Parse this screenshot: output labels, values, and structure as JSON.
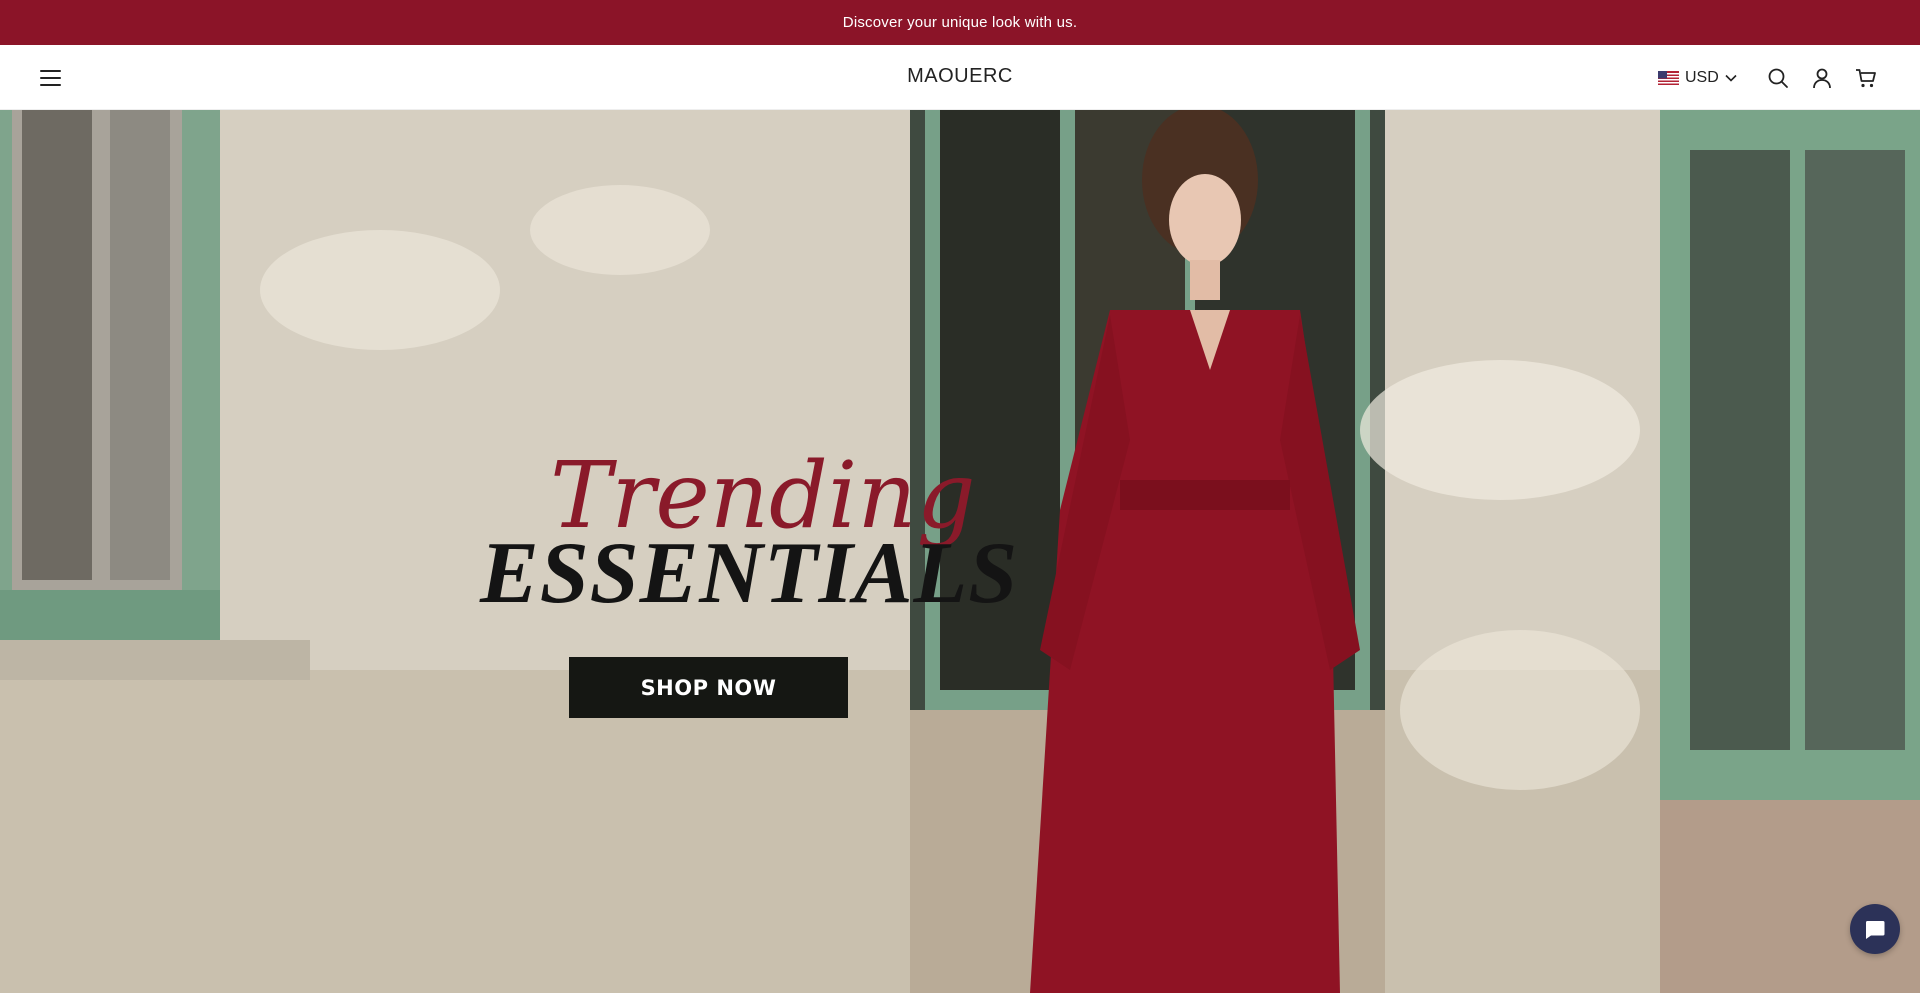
{
  "colors": {
    "announcement_bg": "#8b1428",
    "accent": "#8b1428",
    "trending_text": "#8a1a2a",
    "chat_bg": "#2c3258"
  },
  "announcement": {
    "text": "Discover your unique look with us."
  },
  "header": {
    "logo": "MAOUERC",
    "currency": "USD",
    "icons": [
      "menu-icon",
      "us-flag-icon",
      "chevron-down-icon",
      "search-icon",
      "account-icon",
      "cart-icon"
    ]
  },
  "hero": {
    "title_script": "Trending",
    "title_main": "ESSENTIALS",
    "cta_label": "SHOP NOW"
  },
  "chat": {
    "icon": "chat-icon"
  }
}
